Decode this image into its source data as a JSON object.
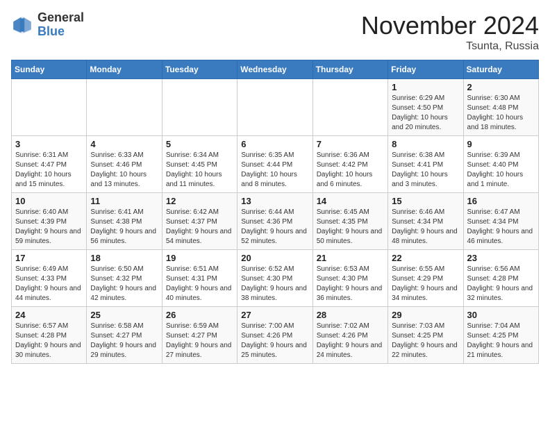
{
  "header": {
    "logo_general": "General",
    "logo_blue": "Blue",
    "month_title": "November 2024",
    "location": "Tsunta, Russia"
  },
  "weekdays": [
    "Sunday",
    "Monday",
    "Tuesday",
    "Wednesday",
    "Thursday",
    "Friday",
    "Saturday"
  ],
  "weeks": [
    [
      {
        "day": "",
        "info": ""
      },
      {
        "day": "",
        "info": ""
      },
      {
        "day": "",
        "info": ""
      },
      {
        "day": "",
        "info": ""
      },
      {
        "day": "",
        "info": ""
      },
      {
        "day": "1",
        "info": "Sunrise: 6:29 AM\nSunset: 4:50 PM\nDaylight: 10 hours and 20 minutes."
      },
      {
        "day": "2",
        "info": "Sunrise: 6:30 AM\nSunset: 4:48 PM\nDaylight: 10 hours and 18 minutes."
      }
    ],
    [
      {
        "day": "3",
        "info": "Sunrise: 6:31 AM\nSunset: 4:47 PM\nDaylight: 10 hours and 15 minutes."
      },
      {
        "day": "4",
        "info": "Sunrise: 6:33 AM\nSunset: 4:46 PM\nDaylight: 10 hours and 13 minutes."
      },
      {
        "day": "5",
        "info": "Sunrise: 6:34 AM\nSunset: 4:45 PM\nDaylight: 10 hours and 11 minutes."
      },
      {
        "day": "6",
        "info": "Sunrise: 6:35 AM\nSunset: 4:44 PM\nDaylight: 10 hours and 8 minutes."
      },
      {
        "day": "7",
        "info": "Sunrise: 6:36 AM\nSunset: 4:42 PM\nDaylight: 10 hours and 6 minutes."
      },
      {
        "day": "8",
        "info": "Sunrise: 6:38 AM\nSunset: 4:41 PM\nDaylight: 10 hours and 3 minutes."
      },
      {
        "day": "9",
        "info": "Sunrise: 6:39 AM\nSunset: 4:40 PM\nDaylight: 10 hours and 1 minute."
      }
    ],
    [
      {
        "day": "10",
        "info": "Sunrise: 6:40 AM\nSunset: 4:39 PM\nDaylight: 9 hours and 59 minutes."
      },
      {
        "day": "11",
        "info": "Sunrise: 6:41 AM\nSunset: 4:38 PM\nDaylight: 9 hours and 56 minutes."
      },
      {
        "day": "12",
        "info": "Sunrise: 6:42 AM\nSunset: 4:37 PM\nDaylight: 9 hours and 54 minutes."
      },
      {
        "day": "13",
        "info": "Sunrise: 6:44 AM\nSunset: 4:36 PM\nDaylight: 9 hours and 52 minutes."
      },
      {
        "day": "14",
        "info": "Sunrise: 6:45 AM\nSunset: 4:35 PM\nDaylight: 9 hours and 50 minutes."
      },
      {
        "day": "15",
        "info": "Sunrise: 6:46 AM\nSunset: 4:34 PM\nDaylight: 9 hours and 48 minutes."
      },
      {
        "day": "16",
        "info": "Sunrise: 6:47 AM\nSunset: 4:34 PM\nDaylight: 9 hours and 46 minutes."
      }
    ],
    [
      {
        "day": "17",
        "info": "Sunrise: 6:49 AM\nSunset: 4:33 PM\nDaylight: 9 hours and 44 minutes."
      },
      {
        "day": "18",
        "info": "Sunrise: 6:50 AM\nSunset: 4:32 PM\nDaylight: 9 hours and 42 minutes."
      },
      {
        "day": "19",
        "info": "Sunrise: 6:51 AM\nSunset: 4:31 PM\nDaylight: 9 hours and 40 minutes."
      },
      {
        "day": "20",
        "info": "Sunrise: 6:52 AM\nSunset: 4:30 PM\nDaylight: 9 hours and 38 minutes."
      },
      {
        "day": "21",
        "info": "Sunrise: 6:53 AM\nSunset: 4:30 PM\nDaylight: 9 hours and 36 minutes."
      },
      {
        "day": "22",
        "info": "Sunrise: 6:55 AM\nSunset: 4:29 PM\nDaylight: 9 hours and 34 minutes."
      },
      {
        "day": "23",
        "info": "Sunrise: 6:56 AM\nSunset: 4:28 PM\nDaylight: 9 hours and 32 minutes."
      }
    ],
    [
      {
        "day": "24",
        "info": "Sunrise: 6:57 AM\nSunset: 4:28 PM\nDaylight: 9 hours and 30 minutes."
      },
      {
        "day": "25",
        "info": "Sunrise: 6:58 AM\nSunset: 4:27 PM\nDaylight: 9 hours and 29 minutes."
      },
      {
        "day": "26",
        "info": "Sunrise: 6:59 AM\nSunset: 4:27 PM\nDaylight: 9 hours and 27 minutes."
      },
      {
        "day": "27",
        "info": "Sunrise: 7:00 AM\nSunset: 4:26 PM\nDaylight: 9 hours and 25 minutes."
      },
      {
        "day": "28",
        "info": "Sunrise: 7:02 AM\nSunset: 4:26 PM\nDaylight: 9 hours and 24 minutes."
      },
      {
        "day": "29",
        "info": "Sunrise: 7:03 AM\nSunset: 4:25 PM\nDaylight: 9 hours and 22 minutes."
      },
      {
        "day": "30",
        "info": "Sunrise: 7:04 AM\nSunset: 4:25 PM\nDaylight: 9 hours and 21 minutes."
      }
    ]
  ]
}
